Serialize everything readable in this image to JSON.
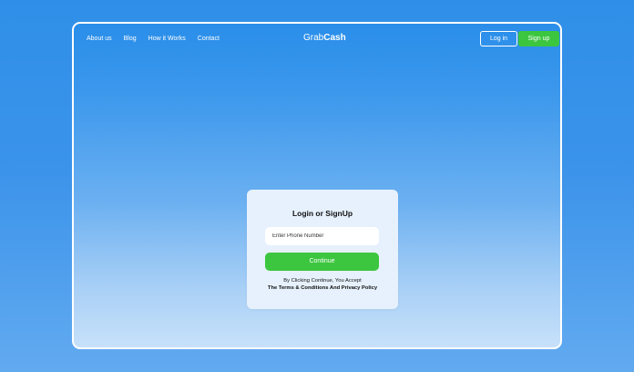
{
  "nav": {
    "links": [
      "About us",
      "Blog",
      "How it Works",
      "Contact"
    ]
  },
  "brand": {
    "light": "Grab",
    "bold": "Cash"
  },
  "auth": {
    "login_label": "Log in",
    "signup_label": "Sign up"
  },
  "card": {
    "title": "Login or SignUp",
    "phone_placeholder": "Enter Phone Number",
    "phone_value": "",
    "continue_label": "Continue",
    "terms_line1": "By Clicking Continue, You Accept",
    "terms_line2": "The Terms & Conditions And Privacy Policy"
  },
  "colors": {
    "accent_green": "#3cc63f",
    "background_blue": "#3a97ec",
    "card_background": "#e6f1fd"
  }
}
